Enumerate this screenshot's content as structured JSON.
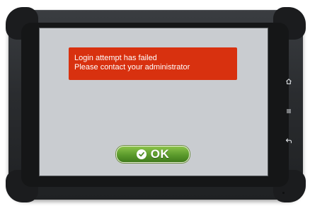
{
  "dialog": {
    "message_line1": "Login attempt has failed",
    "message_line2": "Please contact your administrator",
    "background_color": "#d8310f"
  },
  "ok_button": {
    "label": "OK",
    "icon": "check-circle-icon",
    "color": "#5b9a2c"
  },
  "nav_keys": [
    {
      "icon": "home-icon"
    },
    {
      "icon": "menu-icon"
    },
    {
      "icon": "back-icon"
    }
  ],
  "screen": {
    "background_color": "#c9ccd0"
  }
}
